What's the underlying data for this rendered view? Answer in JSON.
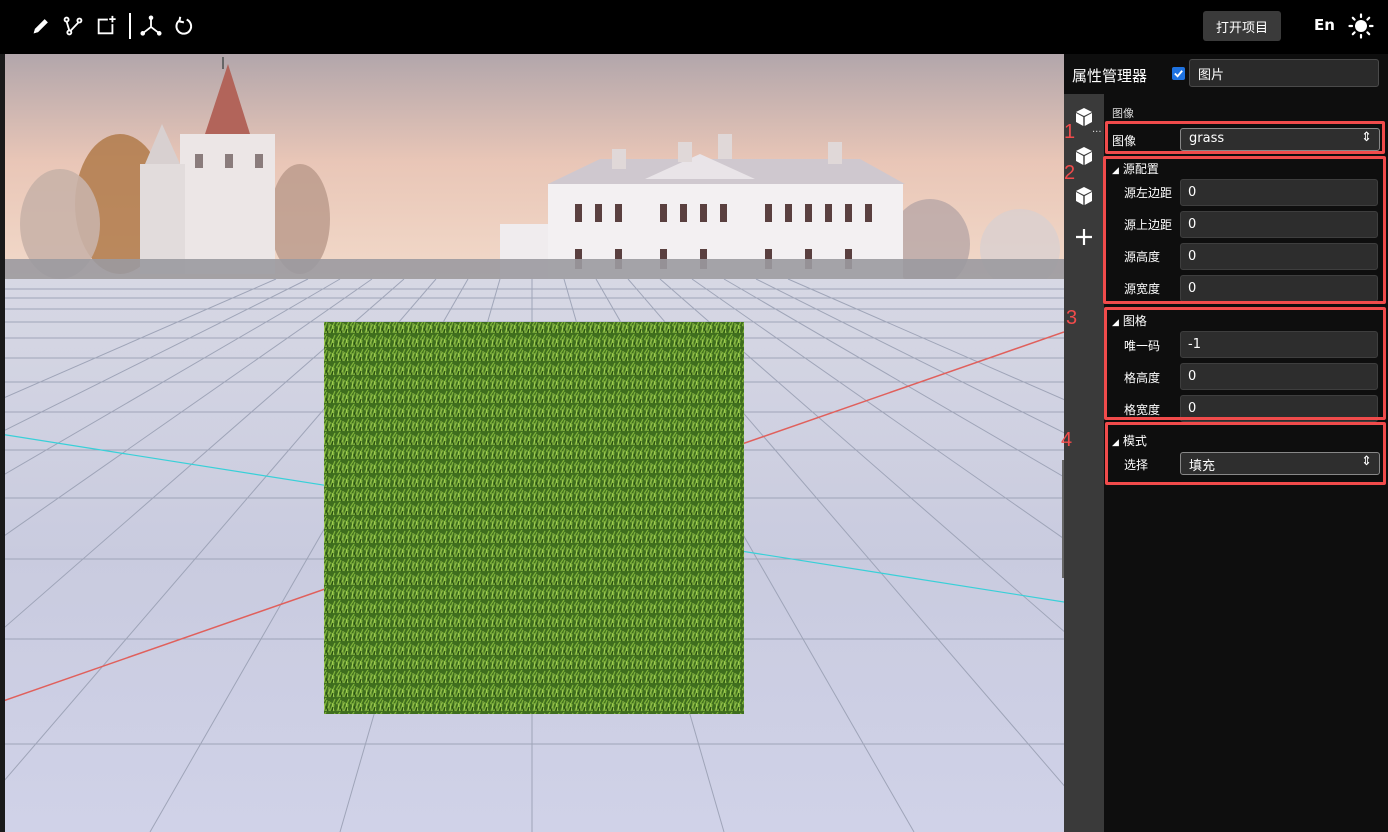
{
  "toolbar": {
    "tools": [
      {
        "name": "pencil-icon"
      },
      {
        "name": "path-edit-icon"
      },
      {
        "name": "add-node-icon"
      },
      {
        "name": "axes-icon"
      },
      {
        "name": "undo-icon"
      }
    ],
    "open_project_label": "打开项目",
    "language_label": "En"
  },
  "panel": {
    "title": "属性管理器",
    "enabled": true,
    "object_name": "图片",
    "image_section_label": "图像",
    "image_label": "图像",
    "image_value": "grass",
    "source_section": {
      "title": "源配置",
      "fields": [
        {
          "label": "源左边距",
          "value": "0"
        },
        {
          "label": "源上边距",
          "value": "0"
        },
        {
          "label": "源高度",
          "value": "0"
        },
        {
          "label": "源宽度",
          "value": "0"
        }
      ]
    },
    "grid_section": {
      "title": "图格",
      "fields": [
        {
          "label": "唯一码",
          "value": "-1"
        },
        {
          "label": "格高度",
          "value": "0"
        },
        {
          "label": "格宽度",
          "value": "0"
        }
      ]
    },
    "mode_section": {
      "title": "模式",
      "select_label": "选择",
      "select_value": "填充"
    }
  },
  "annotations": {
    "labels": [
      "1",
      "2",
      "3",
      "4"
    ],
    "color": "#f04b4b"
  },
  "more_label": "..."
}
